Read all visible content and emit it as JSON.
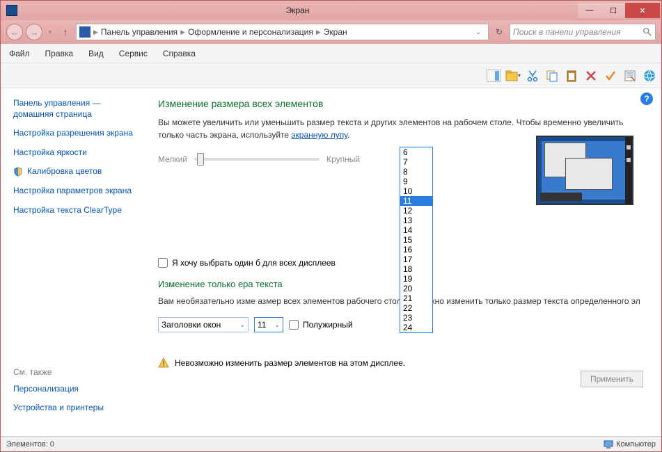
{
  "title": "Экран",
  "nav": {
    "back_symbol": "←",
    "fwd_symbol": "→",
    "up_symbol": "↑"
  },
  "breadcrumb": {
    "items": [
      "Панель управления",
      "Оформление и персонализация",
      "Экран"
    ]
  },
  "search_placeholder": "Поиск в панели управления",
  "menu": [
    "Файл",
    "Правка",
    "Вид",
    "Сервис",
    "Справка"
  ],
  "sidebar": {
    "links": [
      "Панель управления — домашняя страница",
      "Настройка разрешения экрана",
      "Настройка яркости",
      "Калибровка цветов",
      "Настройка параметров экрана",
      "Настройка текста ClearType"
    ],
    "see_also": "См. также",
    "bottom": [
      "Персонализация",
      "Устройства и принтеры"
    ]
  },
  "main": {
    "heading1": "Изменение размера всех элементов",
    "desc_a": "Вы можете увеличить или уменьшить размер текста и других элементов на рабочем столе. Чтобы временно увеличить только часть экрана, используйте ",
    "link_magnifier": "экранную лупу",
    "slider_small": "Мелкий",
    "slider_large": "Крупный",
    "checkbox": "Я хочу выбрать один         б для всех дисплеев",
    "heading2": "Изменение только         ера текста",
    "desc2": "Вам необязательно изме        азмер всех элементов рабочего стола — можно изменить только размер текста определенного эл",
    "combo_category": "Заголовки окон",
    "combo_size": "11",
    "bold_label": "Полужирный",
    "warning": "Невозможно изменить размер элементов на этом дисплее.",
    "apply": "Применить"
  },
  "dropdown": {
    "options": [
      "6",
      "7",
      "8",
      "9",
      "10",
      "11",
      "12",
      "13",
      "14",
      "15",
      "16",
      "17",
      "18",
      "19",
      "20",
      "21",
      "22",
      "23",
      "24"
    ],
    "selected": "11"
  },
  "status": {
    "left": "Элементов: 0",
    "right": "Компьютер"
  }
}
